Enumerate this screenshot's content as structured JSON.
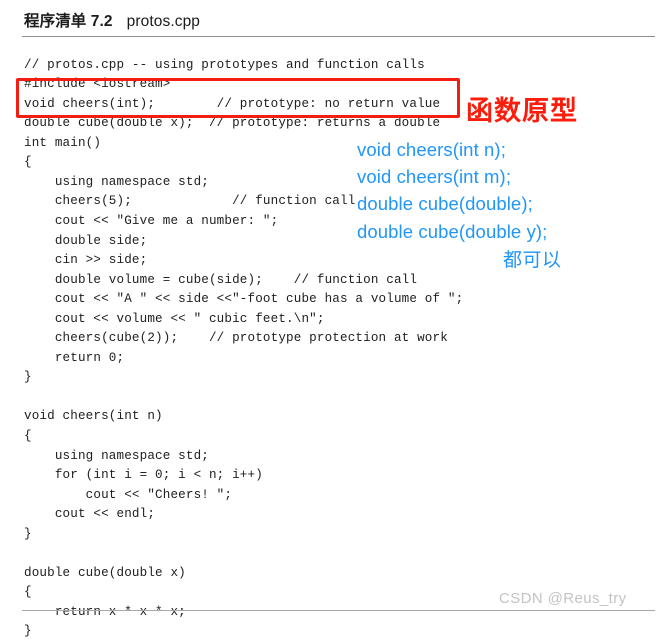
{
  "header": {
    "listing_label": "程序清单 7.2",
    "file_name": "protos.cpp"
  },
  "code": {
    "language": "cpp",
    "lines": [
      "// protos.cpp -- using prototypes and function calls",
      "#include <iostream>",
      "void cheers(int);        // prototype: no return value",
      "double cube(double x);  // prototype: returns a double",
      "int main()",
      "{",
      "    using namespace std;",
      "    cheers(5);             // function call",
      "    cout << \"Give me a number: \";",
      "    double side;",
      "    cin >> side;",
      "    double volume = cube(side);    // function call",
      "    cout << \"A \" << side <<\"-foot cube has a volume of \";",
      "    cout << volume << \" cubic feet.\\n\";",
      "    cheers(cube(2));    // prototype protection at work",
      "    return 0;",
      "}",
      "",
      "void cheers(int n)",
      "{",
      "    using namespace std;",
      "    for (int i = 0; i < n; i++)",
      "        cout << \"Cheers! \";",
      "    cout << endl;",
      "}",
      "",
      "double cube(double x)",
      "{",
      "    return x * x * x;",
      "}"
    ]
  },
  "annotations": {
    "highlight_box": {
      "color": "#f41d12",
      "covers_lines": [
        "void cheers(int);        // prototype: no return value",
        "double cube(double x);  // prototype: returns a double"
      ]
    },
    "red_note": {
      "text": "函数原型",
      "color": "#fb1d0c"
    },
    "blue_color": "#2196f8",
    "blue_lines": [
      "void cheers(int n);",
      "void cheers(int m);",
      "double cube(double);",
      "double cube(double y);"
    ],
    "blue_note": "都可以"
  },
  "watermark": {
    "text": "CSDN @Reus_try",
    "color": "#c3c3c3"
  }
}
